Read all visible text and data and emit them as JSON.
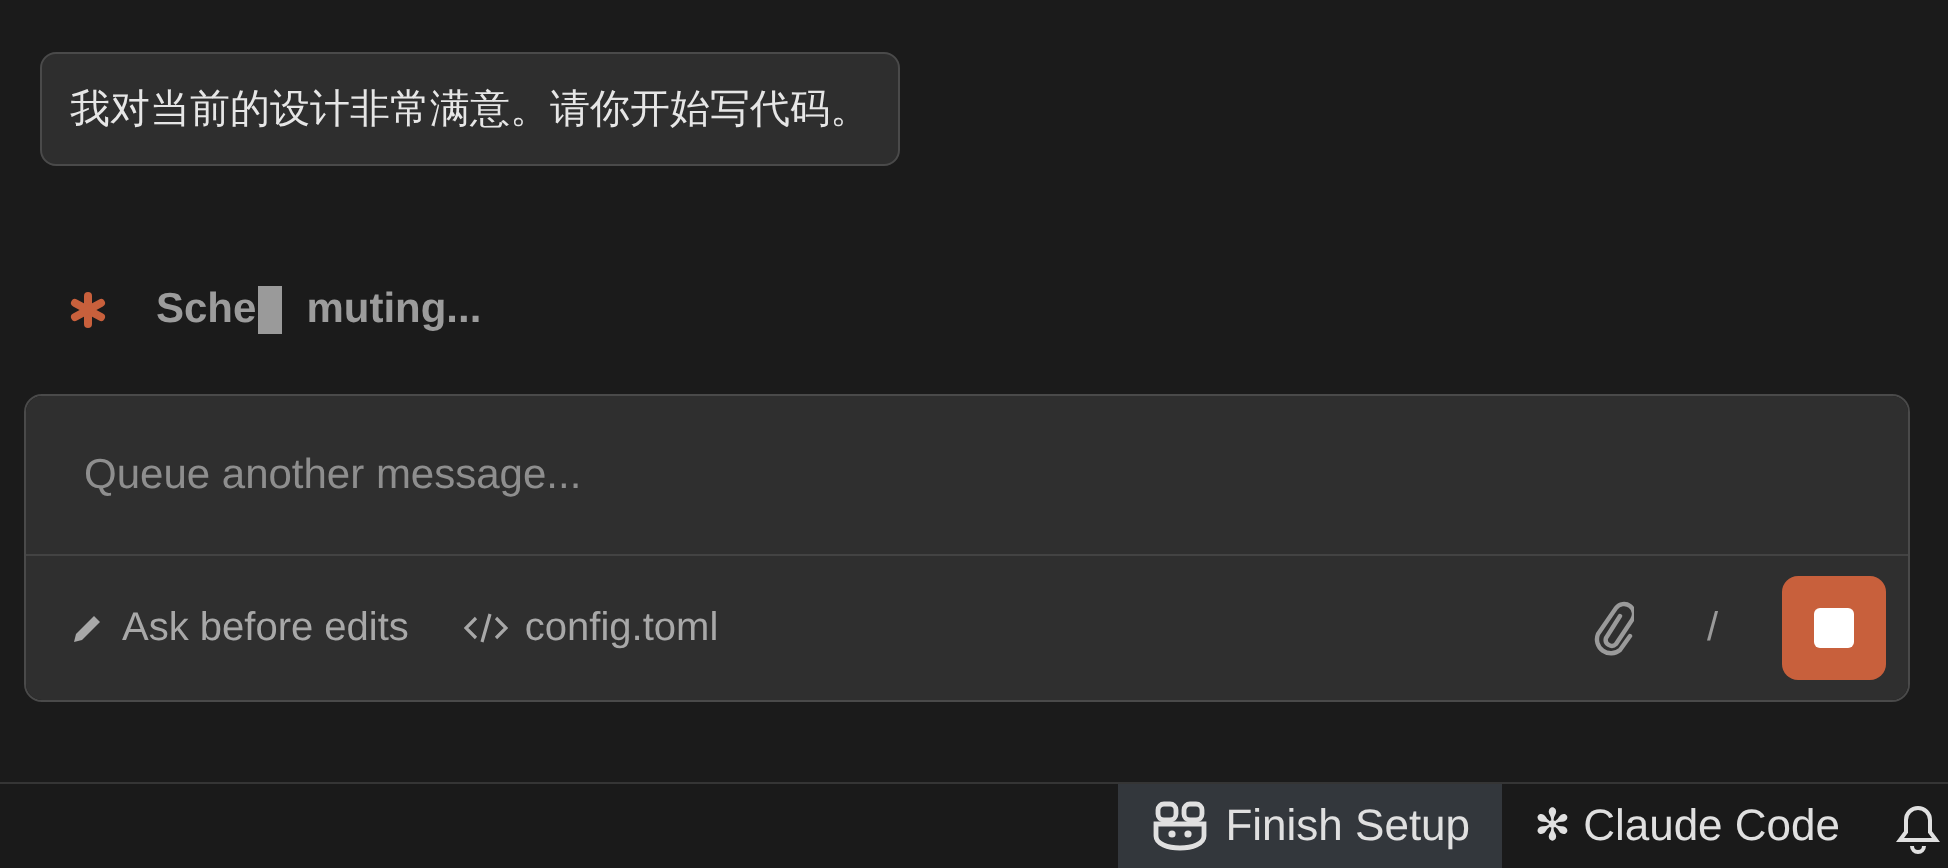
{
  "user_message": "我对当前的设计非常满意。请你开始写代码。",
  "status": {
    "before_cursor": "Sche",
    "after_cursor": "muting..."
  },
  "composer": {
    "placeholder": "Queue another message...",
    "mode": "Ask before edits",
    "file": "config.toml",
    "slash": "/",
    "running": true
  },
  "status_bar": {
    "items": [
      {
        "label": "Finish Setup",
        "selected": true,
        "kind": "copilot"
      },
      {
        "label": "✻ Claude Code",
        "selected": false,
        "kind": "plain"
      }
    ]
  }
}
